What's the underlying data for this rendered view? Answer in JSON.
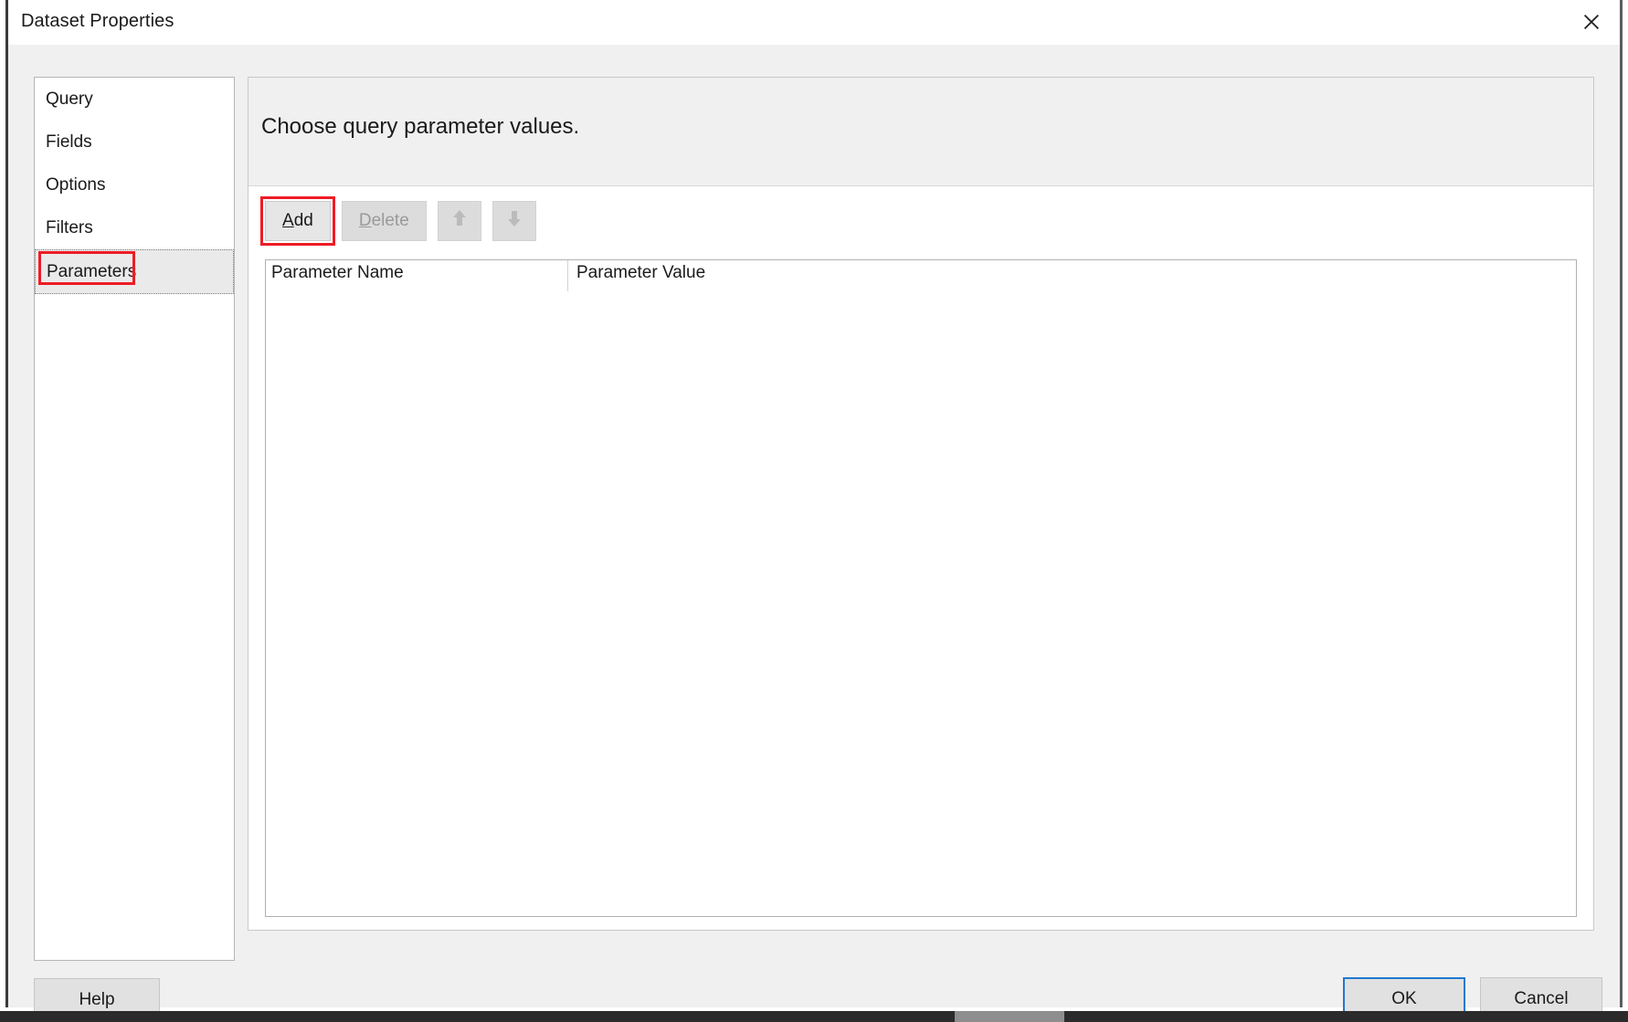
{
  "window": {
    "title": "Dataset Properties",
    "close_icon": "close-icon"
  },
  "sidebar": {
    "items": [
      {
        "label": "Query",
        "selected": false
      },
      {
        "label": "Fields",
        "selected": false
      },
      {
        "label": "Options",
        "selected": false
      },
      {
        "label": "Filters",
        "selected": false
      },
      {
        "label": "Parameters",
        "selected": true
      }
    ]
  },
  "main": {
    "heading": "Choose query parameter values.",
    "toolbar": {
      "add_label": "Add",
      "add_accel": "A",
      "delete_label": "Delete",
      "delete_accel": "D",
      "move_up_icon": "arrow-up-icon",
      "move_down_icon": "arrow-down-icon"
    },
    "grid": {
      "columns": [
        "Parameter Name",
        "Parameter Value"
      ],
      "rows": []
    }
  },
  "footer": {
    "help_label": "Help",
    "ok_label": "OK",
    "cancel_label": "Cancel"
  },
  "colors": {
    "annotation": "#ee1c25",
    "accent_focus": "#2079d2",
    "dialog_bg": "#f0f0f0",
    "button_bg": "#e1e1e1"
  }
}
